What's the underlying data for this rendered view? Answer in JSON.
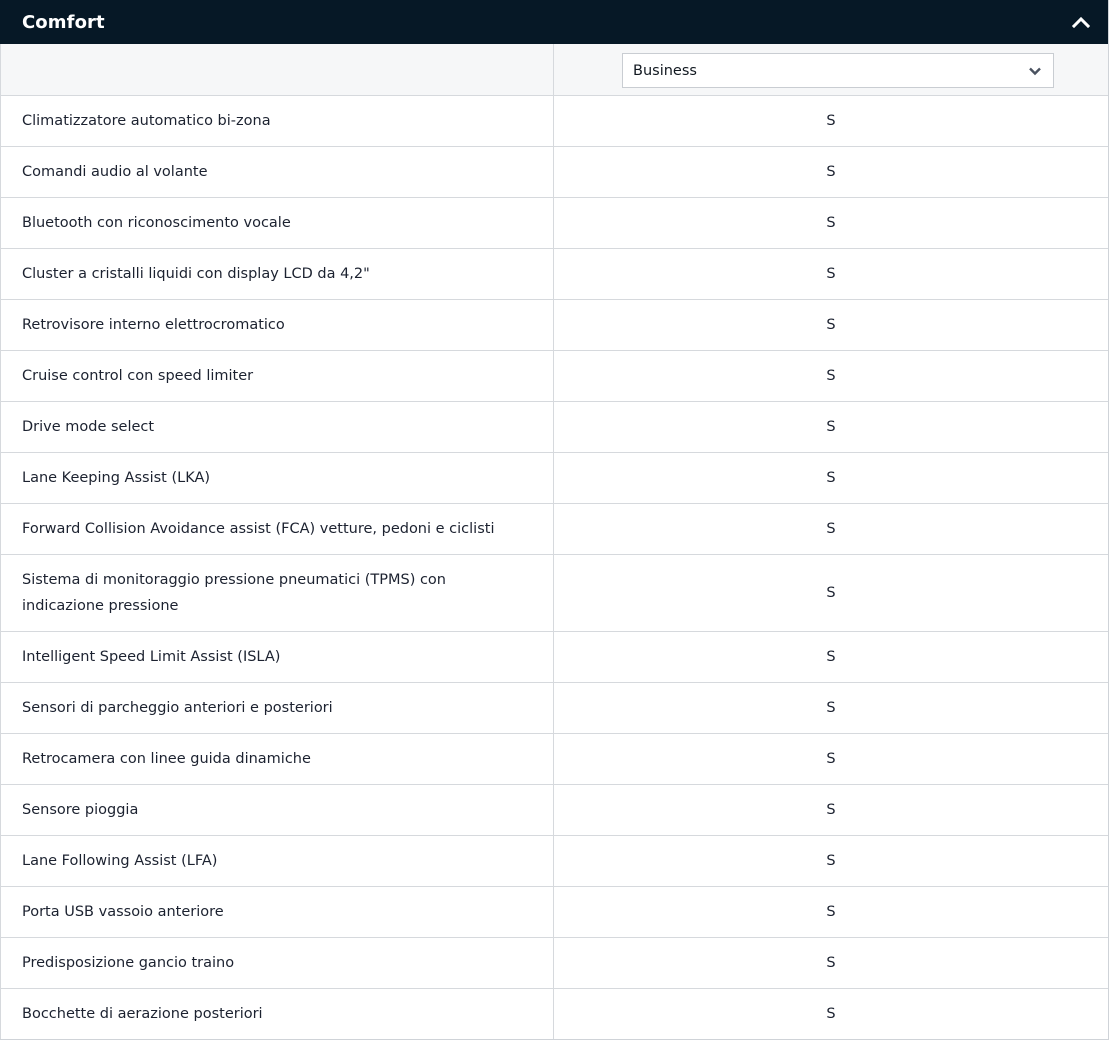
{
  "section": {
    "title": "Comfort",
    "toggle_icon": "chevron-up-icon"
  },
  "version_select": {
    "value": "Business",
    "icon": "chevron-down-icon"
  },
  "rows": [
    {
      "feature": "Climatizzatore automatico bi-zona",
      "value": "S"
    },
    {
      "feature": "Comandi audio al volante",
      "value": "S"
    },
    {
      "feature": "Bluetooth con riconoscimento vocale",
      "value": "S"
    },
    {
      "feature": "Cluster a cristalli liquidi con display LCD da 4,2\"",
      "value": "S"
    },
    {
      "feature": "Retrovisore interno elettrocromatico",
      "value": "S"
    },
    {
      "feature": "Cruise control con speed limiter",
      "value": "S"
    },
    {
      "feature": "Drive mode select",
      "value": "S"
    },
    {
      "feature": "Lane Keeping Assist (LKA)",
      "value": "S"
    },
    {
      "feature": "Forward Collision Avoidance assist (FCA) vetture, pedoni e ciclisti",
      "value": "S"
    },
    {
      "feature": "Sistema di monitoraggio pressione pneumatici (TPMS) con indicazione pressione",
      "value": "S"
    },
    {
      "feature": "Intelligent Speed Limit Assist (ISLA)",
      "value": "S"
    },
    {
      "feature": "Sensori di parcheggio anteriori e posteriori",
      "value": "S"
    },
    {
      "feature": "Retrocamera con linee guida dinamiche",
      "value": "S"
    },
    {
      "feature": "Sensore pioggia",
      "value": "S"
    },
    {
      "feature": "Lane Following Assist (LFA)",
      "value": "S"
    },
    {
      "feature": "Porta USB vassoio anteriore",
      "value": "S"
    },
    {
      "feature": "Predisposizione gancio traino",
      "value": "S"
    },
    {
      "feature": "Bocchette di aerazione posteriori",
      "value": "S"
    }
  ],
  "colors": {
    "header_bg": "#061826",
    "header_text": "#ffffff",
    "border": "#d6d9dd",
    "selector_row_bg": "#f6f7f8"
  }
}
